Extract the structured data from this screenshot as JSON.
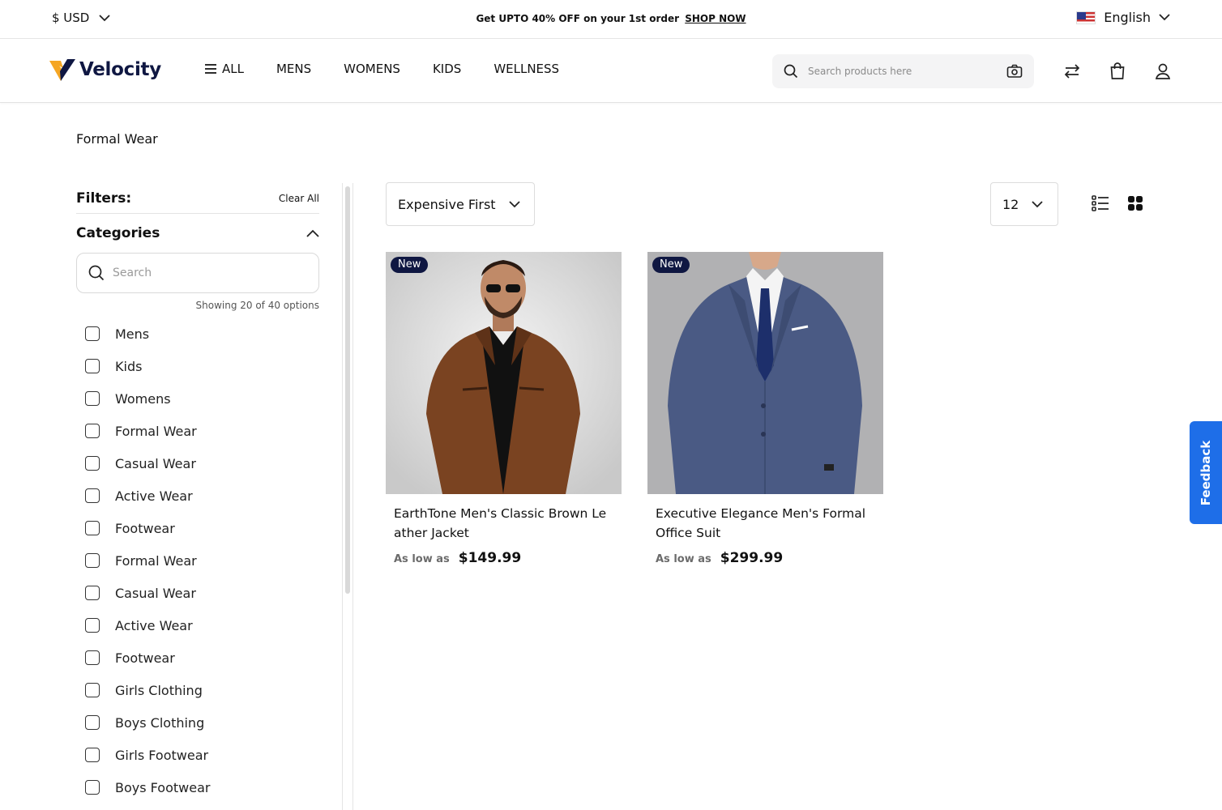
{
  "topbar": {
    "currency": "$ USD",
    "promo_text": "Get UPTO 40% OFF on your 1st order",
    "promo_link": "SHOP NOW",
    "language": "English"
  },
  "header": {
    "brand": "Velocity",
    "nav": [
      "ALL",
      "MENS",
      "WOMENS",
      "KIDS",
      "WELLNESS"
    ],
    "search_placeholder": "Search products here"
  },
  "page": {
    "title": "Formal Wear"
  },
  "filters": {
    "title": "Filters:",
    "clear_all": "Clear All",
    "category_title": "Categories",
    "search_placeholder": "Search",
    "showing": "Showing 20 of 40 options",
    "categories": [
      "Mens",
      "Kids",
      "Womens",
      "Formal Wear",
      "Casual Wear",
      "Active Wear",
      "Footwear",
      "Formal Wear",
      "Casual Wear",
      "Active Wear",
      "Footwear",
      "Girls Clothing",
      "Boys Clothing",
      "Girls Footwear",
      "Boys Footwear"
    ]
  },
  "toolbar": {
    "sort": "Expensive First",
    "limit": "12"
  },
  "products": [
    {
      "badge": "New",
      "name": "EarthTone Men's Classic Brown Le ather Jacket",
      "price_prefix": "As low as",
      "price": "$149.99"
    },
    {
      "badge": "New",
      "name": "Executive Elegance Men's Formal Office Suit",
      "price_prefix": "As low as",
      "price": "$299.99"
    }
  ],
  "feedback": "Feedback",
  "colors": {
    "brand_navy": "#0f1742",
    "logo_orange": "#f5a623",
    "feedback_blue": "#1e6ee8"
  }
}
